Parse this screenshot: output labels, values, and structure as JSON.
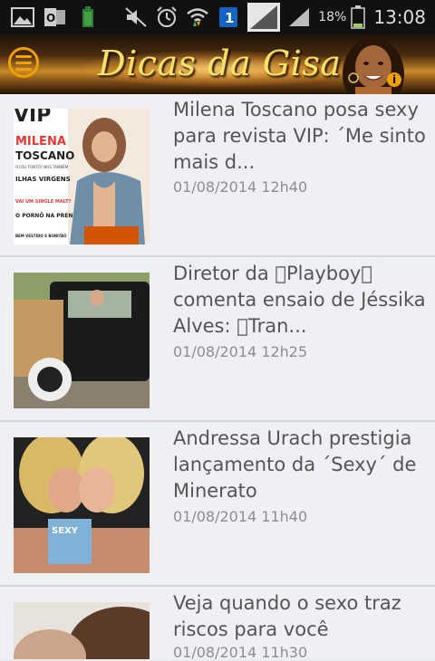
{
  "status_bar": {
    "battery_percent": "18%",
    "time": "13:08",
    "icons": [
      "gallery-icon",
      "outlook-icon",
      "battery-small-icon",
      "mute-icon",
      "alarm-icon",
      "wifi-icon",
      "sim-1-icon",
      "signal-icon",
      "signal-icon-2"
    ]
  },
  "header": {
    "logo_text": "Dicas da Gisa",
    "menu_icon": "hamburger-icon",
    "info_icon": "info-icon",
    "info_glyph": "i"
  },
  "articles": [
    {
      "title": "Milena Toscano posa sexy para revista VIP: ´Me sinto mais d...",
      "date": "01/08/2014 12h40",
      "thumb": "VIP magazine cover",
      "cover_brand": "VIP",
      "cover_name_1": "MILENA",
      "cover_name_2": "TOSCANO",
      "cover_sub": "FICOU TONTO? NÓS TAMBÉM",
      "cover_line_1": "ILHAS VIRGENS",
      "cover_line_2": "VAI UM SINGLE MALT?",
      "cover_line_3": "O PORNÔ NA PRENSA",
      "cover_line_4": "BEM VESTIDO E BONITÃO"
    },
    {
      "title": "Diretor da \u0000Playboy\u0000 comenta ensaio de Jéssika Alves: \u0000Tran...",
      "date": "01/08/2014 12h25",
      "thumb": "woman in vintage car"
    },
    {
      "title": "Andressa Urach prestigia lançamento da ´Sexy´ de Minerato",
      "date": "01/08/2014 11h40",
      "thumb": "two women kissing with magazine",
      "magazine_text": "SEXY"
    },
    {
      "title": "Veja quando o sexo traz riscos para você",
      "date": "01/08/2014 11h30",
      "thumb": "close-up portrait"
    }
  ],
  "colors": {
    "accent": "#f0a000",
    "list_bg": "#eef0f3",
    "title_text": "#555555",
    "date_text": "#8e8e8e"
  }
}
